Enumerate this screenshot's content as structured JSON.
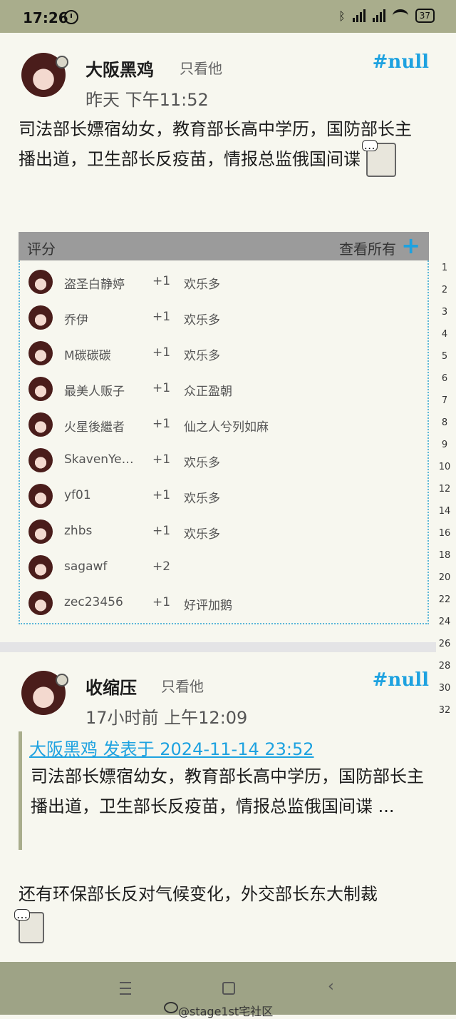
{
  "status": {
    "time": "17:26",
    "battery": "37"
  },
  "post1": {
    "author": "大阪黑鸡",
    "only_him": "只看他",
    "tag": "#null",
    "time": "昨天 下午11:52",
    "body": "司法部长嫖宿幼女，教育部长高中学历，国防部长主播出道，卫生部长反疫苗，情报总监俄国间谍"
  },
  "rating": {
    "label": "评分",
    "view_all": "查看所有",
    "rows": [
      {
        "name": "盗圣白静婷",
        "score": "+1",
        "reason": "欢乐多"
      },
      {
        "name": "乔伊",
        "score": "+1",
        "reason": "欢乐多"
      },
      {
        "name": "M碳碳碳",
        "score": "+1",
        "reason": "欢乐多"
      },
      {
        "name": "最美人贩子",
        "score": "+1",
        "reason": "众正盈朝"
      },
      {
        "name": "火星後繼者",
        "score": "+1",
        "reason": "仙之人兮列如麻"
      },
      {
        "name": "SkavenYe…",
        "score": "+1",
        "reason": "欢乐多"
      },
      {
        "name": "yf01",
        "score": "+1",
        "reason": "欢乐多"
      },
      {
        "name": "zhbs",
        "score": "+1",
        "reason": "欢乐多"
      },
      {
        "name": "sagawf",
        "score": "+2",
        "reason": ""
      },
      {
        "name": "zec23456",
        "score": "+1",
        "reason": "好评加鹅"
      }
    ]
  },
  "line_numbers": [
    "1",
    "2",
    "3",
    "4",
    "5",
    "6",
    "7",
    "8",
    "9",
    "10",
    "12",
    "14",
    "16",
    "18",
    "20",
    "22",
    "24",
    "26",
    "28",
    "30",
    "32"
  ],
  "post2": {
    "author": "收缩压",
    "only_him": "只看他",
    "tag": "#null",
    "time": "17小时前 上午12:09",
    "quote_head": "大阪黑鸡 发表于 2024-11-14 23:52",
    "quote_text": "司法部长嫖宿幼女，教育部长高中学历，国防部长主播出道，卫生部长反疫苗，情报总监俄国间谍 ...",
    "body": "还有环保部长反对气候变化，外交部长东大制裁"
  },
  "watermark": "@stage1st宅社区"
}
